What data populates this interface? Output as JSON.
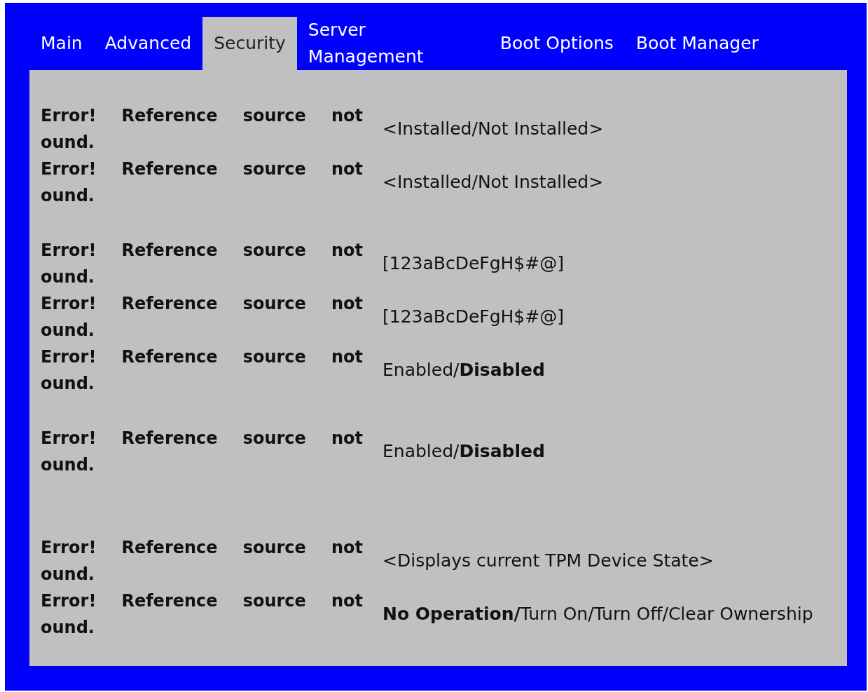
{
  "tabs": [
    {
      "label": "Main",
      "selected": false
    },
    {
      "label": "Advanced",
      "selected": false
    },
    {
      "label": "Security",
      "selected": true
    },
    {
      "label": "Server Management",
      "selected": false
    },
    {
      "label": "Boot Options",
      "selected": false
    },
    {
      "label": "Boot Manager",
      "selected": false
    }
  ],
  "rows": [
    {
      "kind": "setting",
      "label": "Error! Reference source not ound.",
      "value": "<Installed/Not Installed>"
    },
    {
      "kind": "setting",
      "label": "Error! Reference source not ound.",
      "value": "<Installed/Not Installed>"
    },
    {
      "kind": "blank"
    },
    {
      "kind": "setting",
      "label": "Error! Reference source not ound.",
      "value": "[123aBcDeFgH$#@]"
    },
    {
      "kind": "setting",
      "label": "Error! Reference source not ound.",
      "value": "[123aBcDeFgH$#@]"
    },
    {
      "kind": "setting",
      "label": "Error! Reference source not ound.",
      "value": "Enabled/**Disabled**"
    },
    {
      "kind": "blank"
    },
    {
      "kind": "setting",
      "label": "Error! Reference source not ound.",
      "value": "Enabled/**Disabled**"
    },
    {
      "kind": "blank"
    },
    {
      "kind": "blank"
    },
    {
      "kind": "setting",
      "label": "Error! Reference source not ound.",
      "value": "<Displays current TPM Device State>"
    },
    {
      "kind": "setting",
      "label": "Error! Reference source not ound.",
      "value": "**No Operation/**Turn On/Turn Off/Clear Ownership"
    }
  ]
}
